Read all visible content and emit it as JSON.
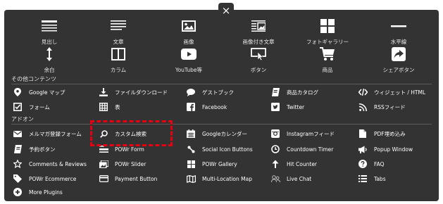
{
  "close_label": "×",
  "main_tiles": [
    {
      "label": "見出し",
      "icon": "heading-icon"
    },
    {
      "label": "文章",
      "icon": "text-icon"
    },
    {
      "label": "画像",
      "icon": "image-icon"
    },
    {
      "label": "画像付き文章",
      "icon": "image-text-icon"
    },
    {
      "label": "フォトギャラリー",
      "icon": "gallery-icon"
    },
    {
      "label": "水平線",
      "icon": "horizontal-line-icon"
    },
    {
      "label": "余白",
      "icon": "spacer-icon"
    },
    {
      "label": "カラム",
      "icon": "column-icon"
    },
    {
      "label": "YouTube等",
      "icon": "youtube-icon"
    },
    {
      "label": "ボタン",
      "icon": "button-icon"
    },
    {
      "label": "商品",
      "icon": "cart-icon"
    },
    {
      "label": "シェアボタン",
      "icon": "share-icon"
    }
  ],
  "other_section_title": "その他コンテンツ",
  "other_items": [
    {
      "label": "Google マップ",
      "icon": "map-pin-icon"
    },
    {
      "label": "ファイルダウンロード",
      "icon": "download-icon"
    },
    {
      "label": "ゲストブック",
      "icon": "chat-icon"
    },
    {
      "label": "商品カタログ",
      "icon": "catalog-icon"
    },
    {
      "label": "ウィジェット / HTML",
      "icon": "code-icon"
    },
    {
      "label": "フォーム",
      "icon": "form-icon"
    },
    {
      "label": "表",
      "icon": "table-icon"
    },
    {
      "label": "Facebook",
      "icon": "facebook-icon"
    },
    {
      "label": "Twitter",
      "icon": "twitter-icon"
    },
    {
      "label": "RSSフィード",
      "icon": "rss-icon"
    }
  ],
  "addon_section_title": "アドオン",
  "addon_items": [
    {
      "label": "メルマガ登録フォーム",
      "icon": "mail-icon"
    },
    {
      "label": "カスタム検索",
      "icon": "search-icon"
    },
    {
      "label": "Googleカレンダー",
      "icon": "calendar-icon"
    },
    {
      "label": "Instagramフィード",
      "icon": "instagram-icon"
    },
    {
      "label": "PDF埋め込み",
      "icon": "pdf-icon"
    },
    {
      "label": "予約ボタン",
      "icon": "reserve-icon"
    },
    {
      "label": "POWr Form",
      "icon": "powr-form-icon"
    },
    {
      "label": "Social Icon Buttons",
      "icon": "social-icon"
    },
    {
      "label": "Countdown Timer",
      "icon": "timer-icon"
    },
    {
      "label": "Popup Window",
      "icon": "megaphone-icon"
    },
    {
      "label": "Comments & Reviews",
      "icon": "star-icon"
    },
    {
      "label": "POWr Slider",
      "icon": "slider-icon"
    },
    {
      "label": "POWr Gallery",
      "icon": "gallery-grid-icon"
    },
    {
      "label": "Hit Counter",
      "icon": "arrow-up-icon"
    },
    {
      "label": "FAQ",
      "icon": "question-icon"
    },
    {
      "label": "POWr Ecommerce",
      "icon": "tag-icon"
    },
    {
      "label": "Payment Button",
      "icon": "payment-icon"
    },
    {
      "label": "Multi-Location Map",
      "icon": "multi-map-icon"
    },
    {
      "label": "Live Chat",
      "icon": "live-chat-icon"
    },
    {
      "label": "Tabs",
      "icon": "tabs-icon"
    },
    {
      "label": "More Plugins",
      "icon": "plus-circle-icon"
    }
  ],
  "highlight_color": "#e60012"
}
